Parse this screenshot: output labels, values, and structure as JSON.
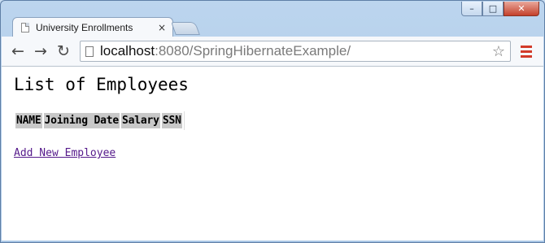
{
  "window": {
    "minimize_glyph": "–",
    "maximize_glyph": "□",
    "close_glyph": "✕"
  },
  "tab": {
    "title": "University Enrollments",
    "close_glyph": "×"
  },
  "toolbar": {
    "back_glyph": "←",
    "forward_glyph": "→",
    "reload_glyph": "↻",
    "url_host": "localhost",
    "url_rest": ":8080/SpringHibernateExample/",
    "star_glyph": "☆"
  },
  "page": {
    "heading": "List of Employees",
    "table_headers": [
      "NAME",
      "Joining Date",
      "Salary",
      "SSN"
    ],
    "add_link": "Add New Employee"
  },
  "colors": {
    "link_visited": "#551a8b",
    "menu_accent": "#d23b2a",
    "header_cell_bg": "#c8c8c8"
  },
  "icons": [
    "page-icon",
    "close-icon",
    "new-tab-icon",
    "back-arrow-icon",
    "forward-arrow-icon",
    "reload-icon",
    "star-icon",
    "menu-icon"
  ]
}
